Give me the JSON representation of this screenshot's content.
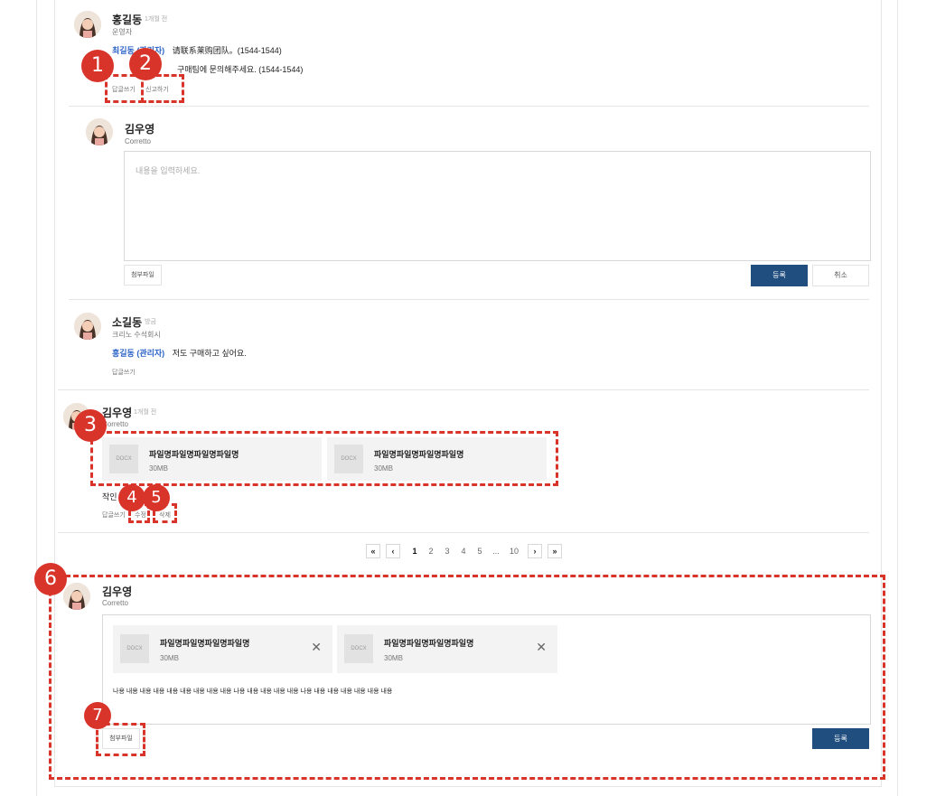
{
  "comment1": {
    "name": "홍길동",
    "time": "1개월 전",
    "role": "운영자",
    "mention": "최길동 (관리자)",
    "line1": "请联系莱购团队。(1544-1544)",
    "line2": "구매팀에 문의해주세요. (1544-1544)",
    "reply_link": "답글쓰기",
    "report_link": "신고하기"
  },
  "reply_editor": {
    "name": "김우영",
    "role": "Corretto",
    "placeholder": "내용을 입력하세요.",
    "attach_label": "첨부파일",
    "submit_label": "등록",
    "cancel_label": "취소"
  },
  "comment2": {
    "name": "소길동",
    "time": "방금",
    "role": "크리노 수석회시",
    "mention": "홍길동 (관리자)",
    "text": "저도 구매하고 싶어요.",
    "reply_link": "답글쓰기"
  },
  "comment3": {
    "name": "김우영",
    "time": "1개월 전",
    "role": "Corretto",
    "files": [
      {
        "thumb": "DOCX",
        "name": "파일명파일명파일명파일명",
        "size": "30MB"
      },
      {
        "thumb": "DOCX",
        "name": "파일명파일명파일명파일명",
        "size": "30MB"
      }
    ],
    "text": "작인",
    "reply_link": "답글쓰기",
    "edit_link": "수정",
    "delete_link": "삭제"
  },
  "pagination": {
    "first": "«",
    "prev": "‹",
    "pages": [
      "1",
      "2",
      "3",
      "4",
      "5",
      "...",
      "10"
    ],
    "next": "›",
    "last": "»",
    "current": "1"
  },
  "edit_comment": {
    "name": "김우영",
    "role": "Corretto",
    "files": [
      {
        "thumb": "DOCX",
        "name": "파일명파일명파일명파일명",
        "size": "30MB",
        "close": "✕"
      },
      {
        "thumb": "DOCX",
        "name": "파일명파일명파일명파일명",
        "size": "30MB",
        "close": "✕"
      }
    ],
    "body": "나용 내용 내용 내용 내용 내용 내용 내용 내용 나용 내용 내용 내용 내용 나용 내용 내용 내용 내용 내용 내용",
    "attach_label": "첨부파일",
    "submit_label": "등록"
  },
  "badges": [
    "1",
    "2",
    "3",
    "4",
    "5",
    "6",
    "7"
  ],
  "colors": {
    "accent_red": "#d8342a",
    "primary_button": "#1f4e7f",
    "mention_blue": "#2b63c7"
  }
}
